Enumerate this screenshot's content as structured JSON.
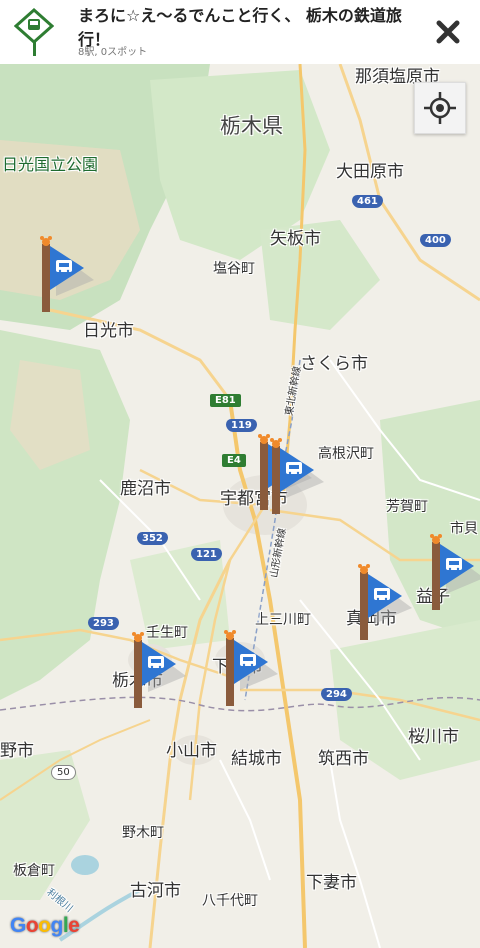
{
  "header": {
    "title": "まろに☆え〜るでんこと行く、 栃木の鉄道旅行！",
    "subtitle": "8駅, 0スポット",
    "close_icon": "close-icon",
    "route_icon": "station-signpost-icon"
  },
  "map": {
    "prefecture_label": "栃木県",
    "park_label": "日光国立公園",
    "city_labels": [
      "那須塩原市",
      "大田原市",
      "矢板市",
      "塩谷町",
      "日光市",
      "さくら市",
      "高根沢町",
      "鹿沼市",
      "宇都宮市",
      "芳賀町",
      "市貝",
      "壬生町",
      "上三川町",
      "真岡市",
      "益子",
      "栃木市",
      "下野市",
      "小山市",
      "結城市",
      "筑西市",
      "桜川市",
      "野市",
      "野木町",
      "板倉町",
      "古河市",
      "下妻市",
      "八千代町"
    ],
    "rail_labels": [
      "東北新幹線",
      "山形新幹線",
      "利根川"
    ],
    "road_shields": [
      {
        "text": "E81",
        "kind": "expressway"
      },
      {
        "text": "E4",
        "kind": "expressway"
      },
      {
        "text": "461",
        "kind": "national"
      },
      {
        "text": "400",
        "kind": "national"
      },
      {
        "text": "119",
        "kind": "national"
      },
      {
        "text": "352",
        "kind": "national"
      },
      {
        "text": "121",
        "kind": "national"
      },
      {
        "text": "293",
        "kind": "national"
      },
      {
        "text": "294",
        "kind": "national"
      },
      {
        "text": "50",
        "kind": "national"
      }
    ],
    "station_flags": 8,
    "locate_icon": "my-location-icon",
    "attribution": "Google",
    "colors": {
      "land": "#f1efe8",
      "forest": "#c9e2c0",
      "mountain": "#e8dcc4",
      "road": "#f6d48f",
      "flag": "#2f76d2",
      "pole": "#8a5b3c"
    }
  }
}
